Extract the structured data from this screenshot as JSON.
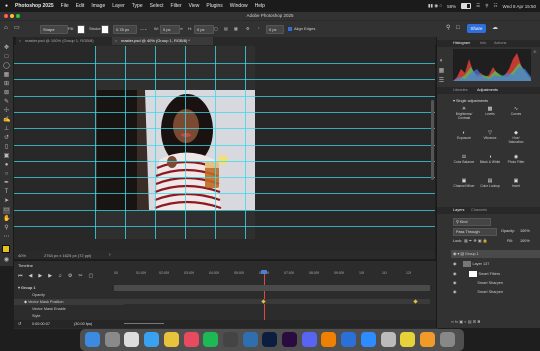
{
  "menubar": {
    "app_name": "Photoshop 2025",
    "menus": [
      "File",
      "Edit",
      "Image",
      "Layer",
      "Type",
      "Select",
      "Filter",
      "View",
      "Plugins",
      "Window",
      "Help"
    ],
    "battery": "58%",
    "datetime": "Wed 8 Apr 15:50"
  },
  "window": {
    "title": "Adobe Photoshop 2025"
  },
  "options_bar": {
    "shape_mode": "Shape",
    "fill_label": "Fill:",
    "stroke_label": "Stroke:",
    "stroke_width": "0.78 px",
    "w_label": "W:",
    "w_value": "0 px",
    "h_label": "H:",
    "h_value": "0 px",
    "radius_value": "0 px",
    "align_edges": "Align Edges",
    "share_label": "Share"
  },
  "tabs": [
    {
      "label": "master.psd @ 100% (Group 1, RGB/8)",
      "active": false
    },
    {
      "label": "master.psd @ 40% (Group 1, RGB/8) *",
      "active": true
    }
  ],
  "status_bar": {
    "zoom": "40%",
    "doc_size": "2764 px x 1625 px (72 ppi)"
  },
  "timeline": {
    "title": "Timeline",
    "ruler_ticks": [
      "00",
      "01:00f",
      "02:00f",
      "03:00f",
      "04:00f",
      "05:00f",
      "06:00f",
      "07:00f",
      "08:00f",
      "09:00f",
      "10f",
      "11f",
      "12f"
    ],
    "rows": [
      "Group 1",
      "Opacity",
      "Vector Mask Position",
      "Vector Mask Enable",
      "Style"
    ],
    "current_time": "0:00:00:07",
    "fps": "(30.00 fps)"
  },
  "histogram_panel": {
    "tabs": [
      "Histogram",
      "Info",
      "Actions"
    ]
  },
  "adjustments_panel": {
    "tabs": [
      "Libraries",
      "Adjustments"
    ],
    "section": "Single adjustments",
    "items": [
      {
        "label": "Brightness/ Contrast",
        "icon": "sun-icon"
      },
      {
        "label": "Levels",
        "icon": "levels-icon"
      },
      {
        "label": "Curves",
        "icon": "curves-icon"
      },
      {
        "label": "Exposure",
        "icon": "exposure-icon"
      },
      {
        "label": "Vibrance",
        "icon": "vibrance-icon"
      },
      {
        "label": "Hue/ Saturation",
        "icon": "hue-icon"
      },
      {
        "label": "Color Balance",
        "icon": "balance-icon"
      },
      {
        "label": "Black & White",
        "icon": "bw-icon"
      },
      {
        "label": "Photo Filter",
        "icon": "camera-icon"
      },
      {
        "label": "Channel Mixer",
        "icon": "channel-icon"
      },
      {
        "label": "Color Lookup",
        "icon": "lookup-icon"
      },
      {
        "label": "Invert",
        "icon": "invert-icon"
      }
    ]
  },
  "layers_panel": {
    "tabs": [
      "Layers",
      "Channels"
    ],
    "filter": "Kind",
    "blend_mode": "Pass Through",
    "opacity_label": "Opacity:",
    "opacity": "100%",
    "lock_label": "Lock:",
    "fill_label": "Fill:",
    "fill": "100%",
    "layers": [
      {
        "name": "Group 1",
        "level": 0
      },
      {
        "name": "Layer 137",
        "level": 1
      },
      {
        "name": "Smart Filters",
        "level": 2
      },
      {
        "name": "Smart Sharpen",
        "level": 3
      },
      {
        "name": "Smart Sharpen",
        "level": 3
      }
    ]
  },
  "dock": {
    "apps": [
      {
        "name": "Finder",
        "color": "#3d8be0"
      },
      {
        "name": "Launchpad",
        "color": "#8a8a8a"
      },
      {
        "name": "Chrome",
        "color": "#ddd"
      },
      {
        "name": "Safari",
        "color": "#3aa0f0"
      },
      {
        "name": "Notes",
        "color": "#e8c23a"
      },
      {
        "name": "Music",
        "color": "#e84a5f"
      },
      {
        "name": "Spotify",
        "color": "#1db954"
      },
      {
        "name": "DaVinci",
        "color": "#444"
      },
      {
        "name": "Lightroom",
        "color": "#2f6fb0"
      },
      {
        "name": "Photoshop",
        "color": "#0b1e3f"
      },
      {
        "name": "Premiere",
        "color": "#2a0b40"
      },
      {
        "name": "Discord",
        "color": "#5865f2"
      },
      {
        "name": "VLC",
        "color": "#f08000"
      },
      {
        "name": "Folder",
        "color": "#2b6fd8"
      },
      {
        "name": "Zoom",
        "color": "#2d8cff"
      },
      {
        "name": "Preview",
        "color": "#bbb"
      },
      {
        "name": "Stickies",
        "color": "#e8d23a"
      },
      {
        "name": "Pages",
        "color": "#f09a2a"
      },
      {
        "name": "Trash",
        "color": "#888"
      }
    ]
  }
}
